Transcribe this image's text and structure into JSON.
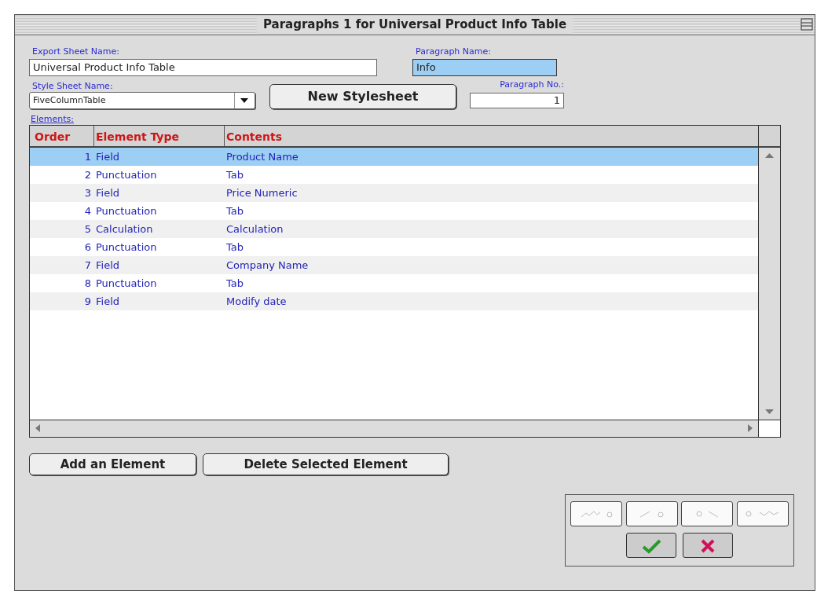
{
  "window": {
    "title": "Paragraphs 1 for Universal Product Info Table"
  },
  "export_sheet_name": {
    "label": "Export Sheet Name:",
    "value": "Universal Product Info Table"
  },
  "paragraph_name": {
    "label": "Paragraph Name:",
    "value": "Info",
    "selected": true
  },
  "style_sheet_name": {
    "label": "Style Sheet Name:",
    "value": "FiveColumnTable"
  },
  "new_stylesheet_button": "New Stylesheet",
  "paragraph_no": {
    "label": "Paragraph No.:",
    "value": "1"
  },
  "elements": {
    "label": "Elements:",
    "columns": [
      "Order",
      "Element Type",
      "Contents"
    ],
    "rows": [
      {
        "order": "1",
        "type": "Field",
        "contents": "Product Name",
        "selected": true
      },
      {
        "order": "2",
        "type": "Punctuation",
        "contents": "Tab",
        "selected": false
      },
      {
        "order": "3",
        "type": "Field",
        "contents": "Price Numeric",
        "selected": false
      },
      {
        "order": "4",
        "type": "Punctuation",
        "contents": "Tab",
        "selected": false
      },
      {
        "order": "5",
        "type": "Calculation",
        "contents": "Calculation",
        "selected": false
      },
      {
        "order": "6",
        "type": "Punctuation",
        "contents": "Tab",
        "selected": false
      },
      {
        "order": "7",
        "type": "Field",
        "contents": "Company Name",
        "selected": false
      },
      {
        "order": "8",
        "type": "Punctuation",
        "contents": "Tab",
        "selected": false
      },
      {
        "order": "9",
        "type": "Field",
        "contents": "Modify date",
        "selected": false
      }
    ]
  },
  "buttons": [
    "Add an Element",
    "Delete Selected Element"
  ],
  "nav_buttons": [
    {
      "kind": "first",
      "disabled": true
    },
    {
      "kind": "previous",
      "disabled": true
    },
    {
      "kind": "next",
      "disabled": true
    },
    {
      "kind": "last",
      "disabled": true
    }
  ],
  "action_buttons": [
    {
      "kind": "ok"
    },
    {
      "kind": "cancel"
    }
  ]
}
